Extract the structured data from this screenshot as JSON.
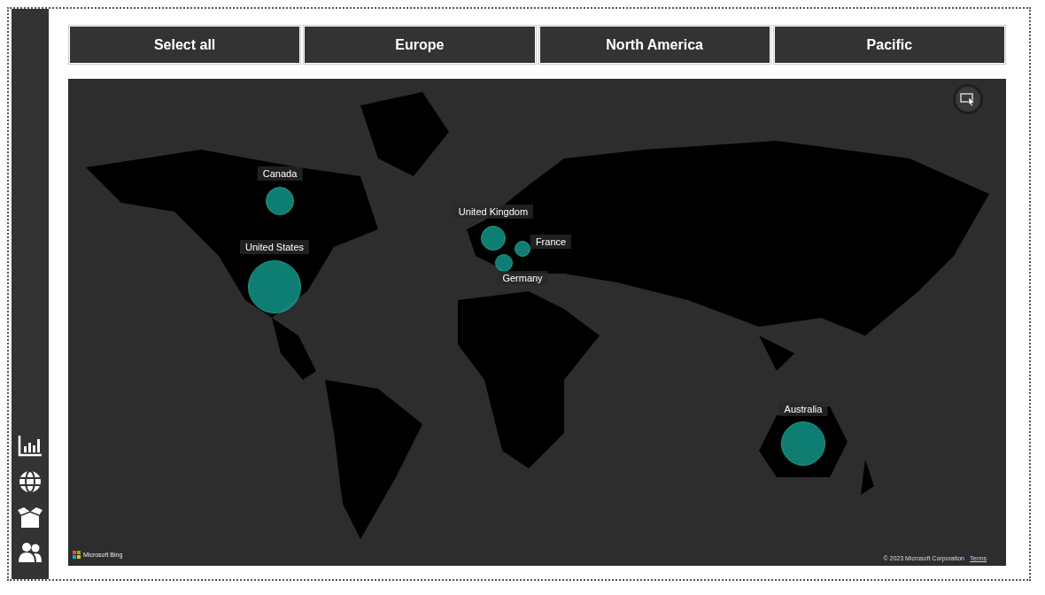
{
  "slicer": {
    "buttons": [
      {
        "label": "Select all"
      },
      {
        "label": "Europe"
      },
      {
        "label": "North America"
      },
      {
        "label": "Pacific"
      }
    ]
  },
  "map": {
    "bubbles": [
      {
        "label": "Canada"
      },
      {
        "label": "United States"
      },
      {
        "label": "United Kingdom"
      },
      {
        "label": "France"
      },
      {
        "label": "Germany"
      },
      {
        "label": "Australia"
      }
    ],
    "logo": "Microsoft Bing",
    "copyright": "© 2023 Microsoft Corporation",
    "terms_link": "Terms"
  }
}
